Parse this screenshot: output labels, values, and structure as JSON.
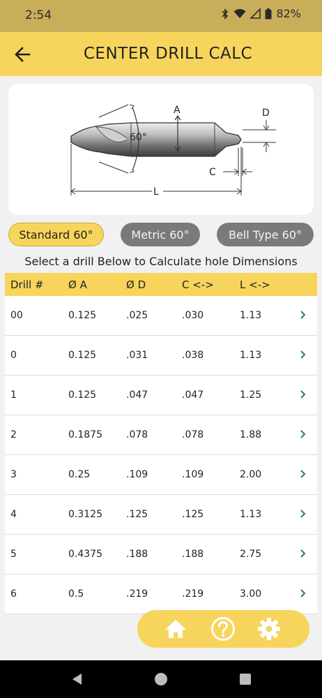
{
  "status": {
    "time": "2:54",
    "battery": "82%"
  },
  "appbar": {
    "title": "CENTER DRILL CALC"
  },
  "diagram": {
    "labels": {
      "a": "A",
      "d": "D",
      "angle": "60°",
      "c": "C",
      "l": "L"
    }
  },
  "chips": [
    {
      "label": "Standard 60°",
      "selected": true
    },
    {
      "label": "Metric 60°",
      "selected": false
    },
    {
      "label": "Bell Type 60°",
      "selected": false
    }
  ],
  "instruction": "Select a drill Below to Calculate hole Dimensions",
  "table": {
    "headers": [
      "Drill #",
      "Ø A",
      "Ø D",
      "C <->",
      "L <->"
    ],
    "rows": [
      [
        "00",
        "0.125",
        ".025",
        ".030",
        "1.13"
      ],
      [
        "0",
        "0.125",
        ".031",
        ".038",
        "1.13"
      ],
      [
        "1",
        "0.125",
        ".047",
        ".047",
        "1.25"
      ],
      [
        "2",
        "0.1875",
        ".078",
        ".078",
        "1.88"
      ],
      [
        "3",
        "0.25",
        ".109",
        ".109",
        "2.00"
      ],
      [
        "4",
        "0.3125",
        ".125",
        ".125",
        "1.13"
      ],
      [
        "5",
        "0.4375",
        ".188",
        ".188",
        "2.75"
      ],
      [
        "6",
        "0.5",
        ".219",
        ".219",
        "3.00"
      ]
    ]
  },
  "colors": {
    "accent": "#f7d55c",
    "statusbar": "#c9ae5a",
    "chevron": "#2e7d5b",
    "chip_inactive": "#7a7a7a"
  },
  "icons": {
    "back": "arrow-left-icon",
    "home": "home-icon",
    "help": "help-circle-icon",
    "settings": "gear-icon"
  }
}
